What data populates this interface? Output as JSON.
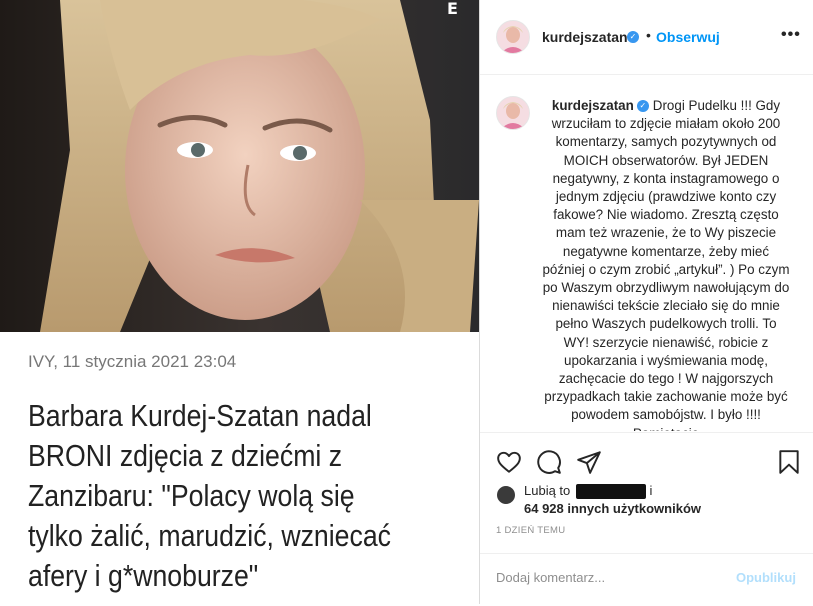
{
  "article": {
    "corner_mark": "E",
    "date": "IVY, 11 stycznia 2021 23:04",
    "title_lines": [
      "Barbara Kurdej-Szatan nadal",
      "BRONI zdjęcia z dziećmi z",
      "Zanzibaru: \"Polacy wolą się",
      "tylko żalić, marudzić, wzniecać",
      "afery i g*wnoburze\""
    ]
  },
  "post": {
    "username": "kurdejszatan",
    "verified_icon": "✓",
    "dot": "•",
    "follow_label": "Obserwuj",
    "more_label": "•••",
    "caption_username": "kurdejszatan",
    "caption_text": "Drogi Pudelku !!! Gdy wrzuciłam to zdjęcie miałam około 200 komentarzy, samych pozytywnych od MOICH obserwatorów. Był JEDEN negatywny, z konta instagramowego o jednym zdjęciu (prawdziwe konto czy fakowe? Nie wiadomo. Zresztą często mam też wrazenie, że to Wy piszecie negatywne komentarze, żeby mieć później o czym zrobić „artykuł”. ) Po czym po Waszym obrzydliwym nawołującym do nienawiści tekście zleciało się do mnie pełno Waszych pudelkowych trolli. To WY! szerzycie nienawiść, robicie z upokarzania i wyśmiewania modę, zachęcacie do tego ! W najgorszych przypadkach takie zachowanie może być powodem samobójstw. I było !!!! Pamiętacie",
    "icons": [
      "heart-icon",
      "comment-icon",
      "share-icon",
      "bookmark-icon"
    ],
    "likes_prefix": "Lubią to",
    "likes_suffix": "i",
    "likes_count": "64 928 innych użytkowników",
    "timestamp": "1 DZIEŃ TEMU",
    "comment_placeholder": "Dodaj komentarz...",
    "publish_label": "Opublikuj"
  },
  "colors": {
    "accent": "#0095f6",
    "verified": "#3897f0",
    "publish_disabled": "#b2dffc"
  }
}
